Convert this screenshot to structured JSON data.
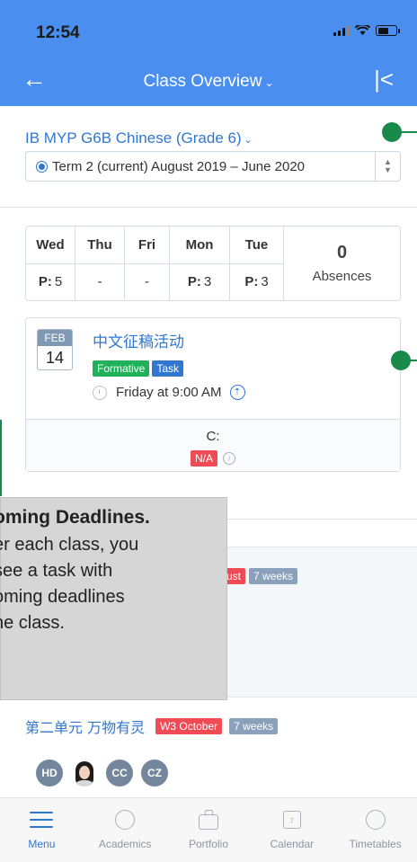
{
  "status_bar": {
    "time": "12:54"
  },
  "header": {
    "back_icon": "←",
    "title": "Class Overview",
    "title_chevron": "⌄",
    "collapse_icon": "|<"
  },
  "class_info": {
    "name": "IB MYP G6B Chinese (Grade 6)",
    "name_chevron": "⌄",
    "term": "Term 2 (current) August 2019 – June 2020"
  },
  "attendance": {
    "days": [
      {
        "day": "Wed",
        "value_prefix": "P:",
        "value": "5"
      },
      {
        "day": "Thu",
        "value_prefix": "",
        "value": "-"
      },
      {
        "day": "Fri",
        "value_prefix": "",
        "value": "-"
      },
      {
        "day": "Mon",
        "value_prefix": "P:",
        "value": "3"
      },
      {
        "day": "Tue",
        "value_prefix": "P:",
        "value": "3"
      }
    ],
    "absences_count": "0",
    "absences_label": "Absences"
  },
  "task": {
    "month": "FEB",
    "day": "14",
    "title": "中文征稿活动",
    "tag_formative": "Formative",
    "tag_task": "Task",
    "time": "Friday at 9:00 AM",
    "grade_label": "C:",
    "grade_value": "N/A",
    "info_icon": "i"
  },
  "unit1": {
    "tag_date_partial": "ust",
    "tag_duration": "7 weeks"
  },
  "unit2": {
    "title": "第二单元 万物有灵",
    "tag_date": "W3 October",
    "tag_duration": "7 weeks"
  },
  "avatars": [
    "HD",
    "CC",
    "CZ"
  ],
  "tooltip": {
    "title": "oming Deadlines.",
    "lines": [
      "er each class, you",
      "see a task with",
      "oming deadlines",
      "he class."
    ]
  },
  "tabbar": [
    {
      "label": "Menu",
      "icon": "menu-icon"
    },
    {
      "label": "Academics",
      "icon": "gauge-icon"
    },
    {
      "label": "Portfolio",
      "icon": "briefcase-icon"
    },
    {
      "label": "Calendar",
      "icon": "calendar-icon"
    },
    {
      "label": "Timetables",
      "icon": "clock-icon"
    }
  ],
  "calendar_icon_day": "7",
  "colors": {
    "header_blue": "#4a8ff0",
    "link_blue": "#2f77d0",
    "green_tag": "#20b15a",
    "red_tag": "#ef4b55",
    "grey_tag": "#8aa0bb",
    "tutorial_green": "#1a8a4a",
    "tooltip_bg": "#d6d6d6"
  }
}
